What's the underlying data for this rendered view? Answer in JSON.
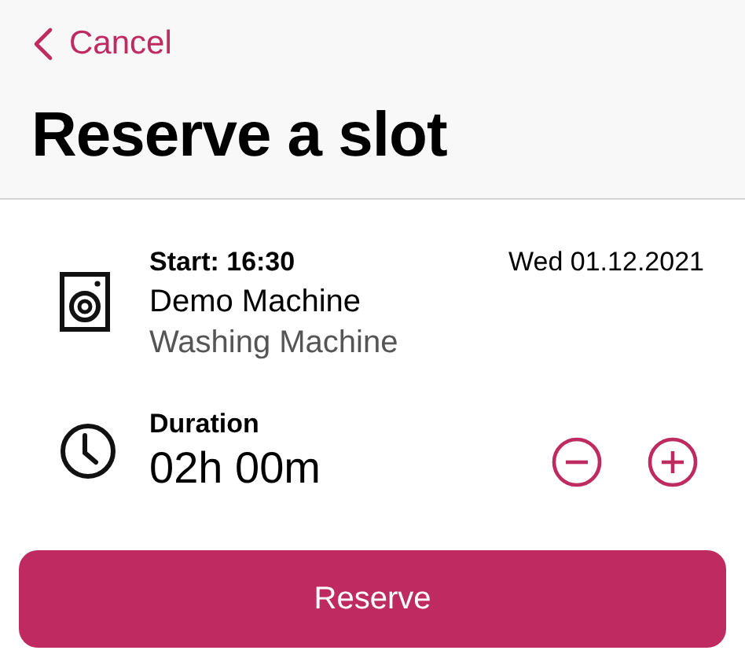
{
  "nav": {
    "back_label": "Cancel"
  },
  "title": "Reserve a slot",
  "slot": {
    "start": "Start: 16:30",
    "date": "Wed 01.12.2021",
    "machine_name": "Demo Machine",
    "machine_type": "Washing Machine"
  },
  "duration": {
    "label": "Duration",
    "value": "02h 00m"
  },
  "primary_button": "Reserve"
}
